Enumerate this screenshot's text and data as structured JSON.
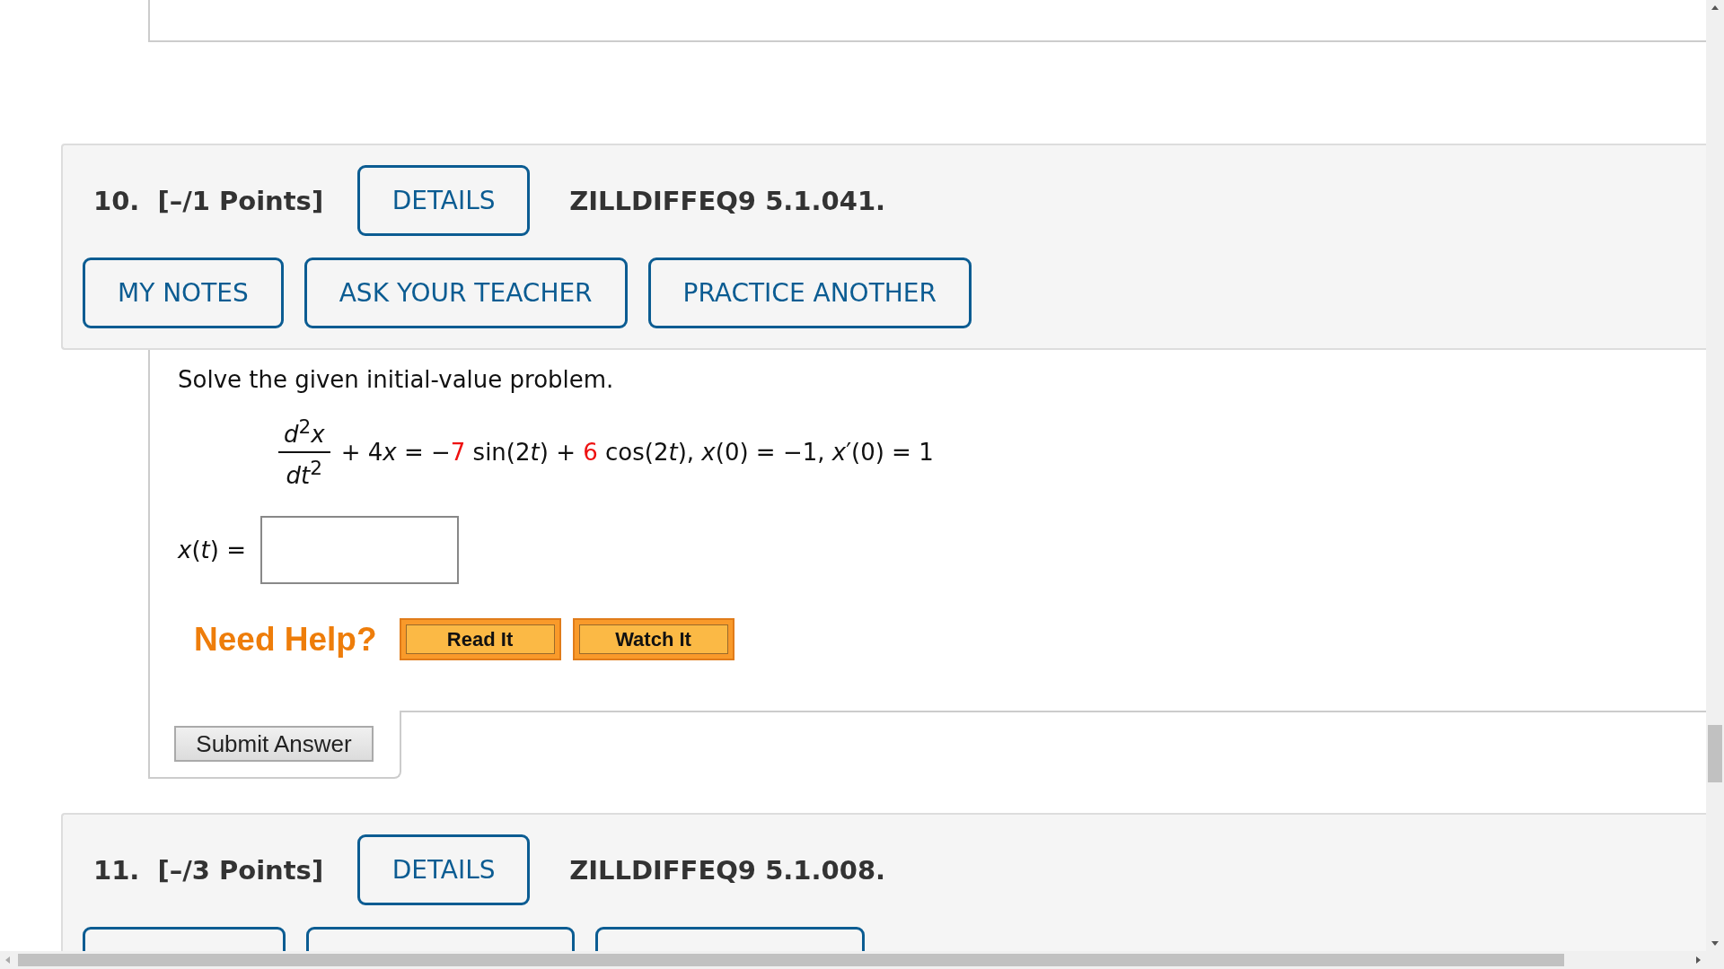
{
  "questions": [
    {
      "number": "10.",
      "points": "[–/1 Points]",
      "details_button": "DETAILS",
      "code": "ZILLDIFFEQ9 5.1.041.",
      "buttons": [
        "MY NOTES",
        "ASK YOUR TEACHER",
        "PRACTICE ANOTHER"
      ],
      "prompt": "Solve the given initial-value problem.",
      "equation": {
        "numerator": "*d*$^{2}$*x*",
        "denominator": "*dt*$^{2}$",
        "segments": [
          {
            "kind": "text",
            "text": "+ 4"
          },
          {
            "kind": "var",
            "text": "x"
          },
          {
            "kind": "text",
            "text": " = −"
          },
          {
            "kind": "value",
            "text": "7"
          },
          {
            "kind": "text",
            "text": " sin(2"
          },
          {
            "kind": "var",
            "text": "t"
          },
          {
            "kind": "text",
            "text": ") + "
          },
          {
            "kind": "value",
            "text": "6"
          },
          {
            "kind": "text",
            "text": " cos(2"
          },
          {
            "kind": "var",
            "text": "t"
          },
          {
            "kind": "text",
            "text": "), "
          },
          {
            "kind": "var",
            "text": "x"
          },
          {
            "kind": "text",
            "text": "(0) = −1,  "
          },
          {
            "kind": "var",
            "text": "x"
          },
          {
            "kind": "text",
            "text": "′(0) = 1"
          }
        ]
      },
      "answer_label": "*x*(*t*) =",
      "help_label": "Need Help?",
      "help_buttons": [
        "Read It",
        "Watch It"
      ],
      "submit": "Submit Answer"
    },
    {
      "number": "11.",
      "points": "[–/3 Points]",
      "details_button": "DETAILS",
      "code": "ZILLDIFFEQ9 5.1.008."
    }
  ]
}
